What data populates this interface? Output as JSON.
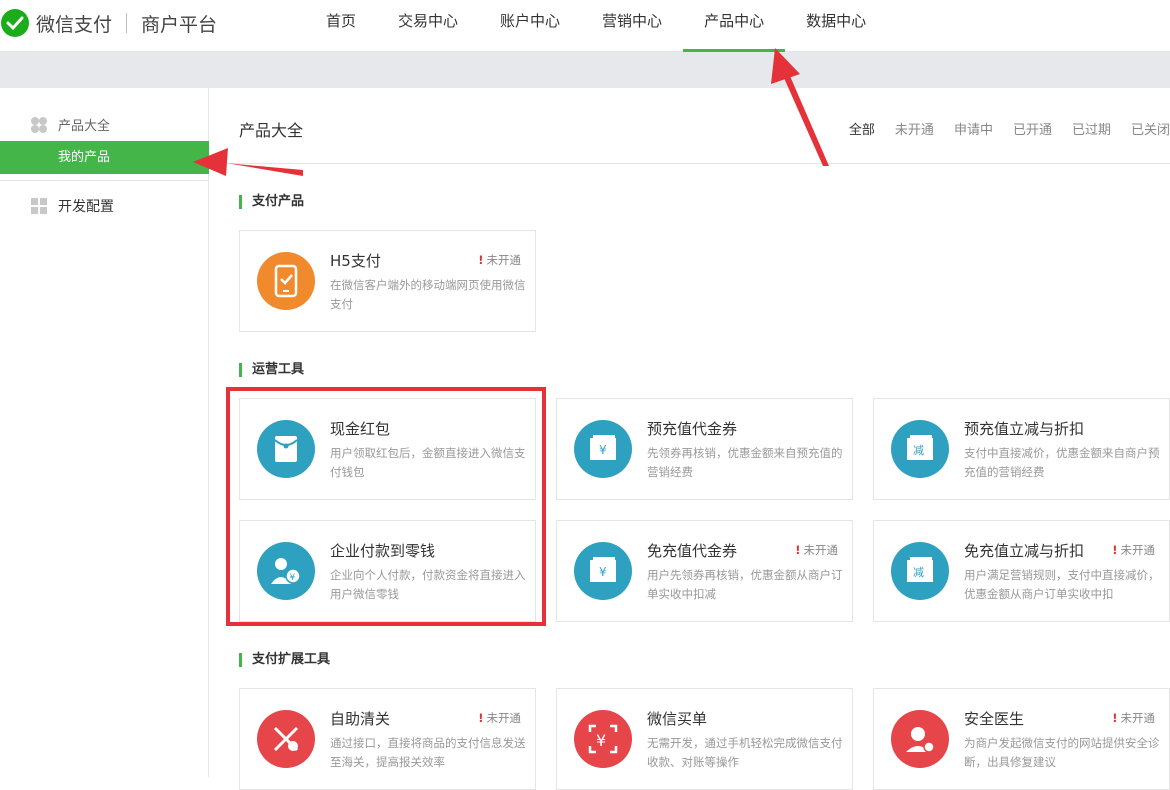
{
  "header": {
    "brand": "微信支付",
    "subtitle": "商户平台",
    "nav": [
      {
        "label": "首页"
      },
      {
        "label": "交易中心"
      },
      {
        "label": "账户中心"
      },
      {
        "label": "营销中心"
      },
      {
        "label": "产品中心"
      },
      {
        "label": "数据中心"
      }
    ],
    "active_nav": "产品中心"
  },
  "sidebar": {
    "group": "产品大全",
    "active_item": "我的产品",
    "dev": "开发配置"
  },
  "main": {
    "title": "产品大全",
    "filters": [
      "全部",
      "未开通",
      "申请中",
      "已开通",
      "已过期",
      "已关闭"
    ],
    "active_filter": "全部"
  },
  "sections": [
    {
      "title": "支付产品",
      "cards": [
        {
          "name": "H5支付",
          "desc": "在微信客户端外的移动端网页使用微信支付",
          "status": "未开通",
          "icon": "phone-icon",
          "color": "#f08a2c"
        }
      ]
    },
    {
      "title": "运营工具",
      "cards": [
        {
          "name": "现金红包",
          "desc": "用户领取红包后，金额直接进入微信支付钱包",
          "status": "",
          "icon": "red-envelope-icon",
          "color": "#2fa1c0"
        },
        {
          "name": "预充值代金券",
          "desc": "先领券再核销，优惠金额来自预充值的营销经费",
          "status": "",
          "icon": "coupon-icon",
          "color": "#2fa1c0"
        },
        {
          "name": "预充值立减与折扣",
          "desc": "支付中直接减价，优惠金额来自商户预充值的营销经费",
          "status": "",
          "icon": "discount-icon",
          "color": "#2fa1c0"
        },
        {
          "name": "企业付款到零钱",
          "desc": "企业向个人付款，付款资金将直接进入用户微信零钱",
          "status": "",
          "icon": "enterprise-pay-icon",
          "color": "#2fa1c0"
        },
        {
          "name": "免充值代金券",
          "desc": "用户先领券再核销，优惠金额从商户订单实收中扣减",
          "status": "未开通",
          "icon": "coupon-icon",
          "color": "#2fa1c0"
        },
        {
          "name": "免充值立减与折扣",
          "desc": "用户满足营销规则，支付中直接减价，优惠金额从商户订单实收中扣",
          "status": "未开通",
          "icon": "discount-icon",
          "color": "#2fa1c0"
        }
      ]
    },
    {
      "title": "支付扩展工具",
      "cards": [
        {
          "name": "自助清关",
          "desc": "通过接口，直接将商品的支付信息发送至海关，提高报关效率",
          "status": "未开通",
          "icon": "customs-icon",
          "color": "#e6454a"
        },
        {
          "name": "微信买单",
          "desc": "无需开发，通过手机轻松完成微信支付收款、对账等操作",
          "status": "",
          "icon": "scan-pay-icon",
          "color": "#e6454a"
        },
        {
          "name": "安全医生",
          "desc": "为商户发起微信支付的网站提供安全诊断，出具修复建议",
          "status": "未开通",
          "icon": "security-doctor-icon",
          "color": "#e6454a"
        }
      ]
    }
  ],
  "annotations": {
    "highlight_color": "#e5313a",
    "arrow_color": "#e5313a"
  }
}
